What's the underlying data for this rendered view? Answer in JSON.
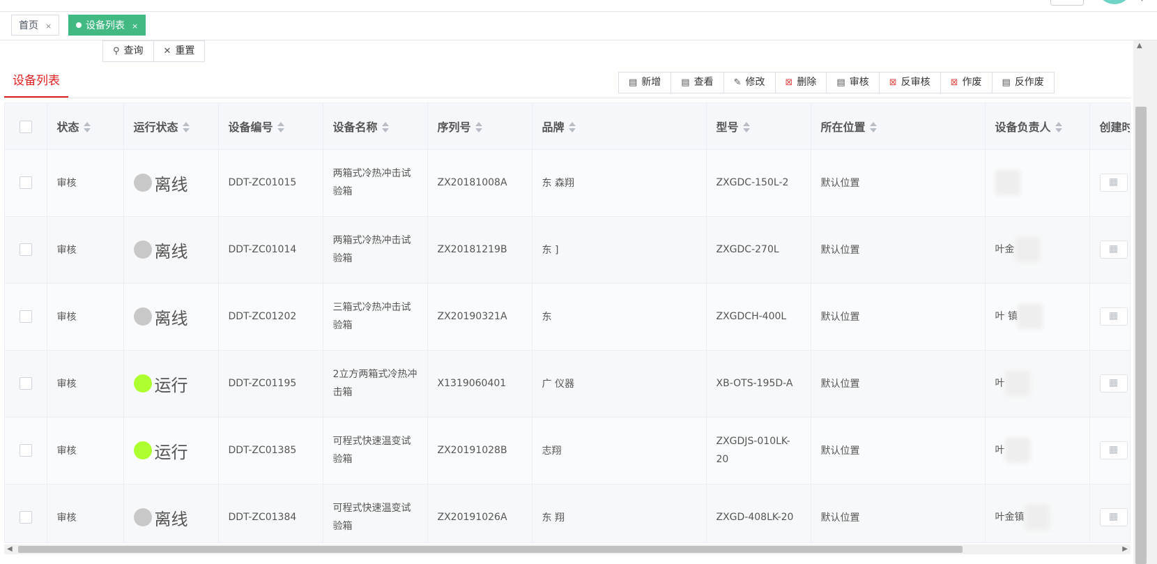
{
  "tags": [
    {
      "label": "首页",
      "active": false
    },
    {
      "label": "设备列表",
      "active": true
    }
  ],
  "query": {
    "search_label": "查询",
    "reset_label": "重置"
  },
  "list_title": "设备列表",
  "toolbar": {
    "add": "新增",
    "view": "查看",
    "edit": "修改",
    "delete": "删除",
    "audit": "审核",
    "unaudit": "反审核",
    "void": "作废",
    "unvoid": "反作废"
  },
  "table": {
    "columns": [
      "状态",
      "运行状态",
      "设备编号",
      "设备名称",
      "序列号",
      "品牌",
      "型号",
      "所在位置",
      "设备负责人",
      "创建时"
    ],
    "rows": [
      {
        "status": "审核",
        "run": "离线",
        "code": "DDT-ZC01015",
        "name": "两箱式冷热冲击试验箱",
        "serial": "ZX20181008A",
        "brand": "东   森翔",
        "model": "ZXGDC-150L-2",
        "location": "默认位置",
        "owner": ""
      },
      {
        "status": "审核",
        "run": "离线",
        "code": "DDT-ZC01014",
        "name": "两箱式冷热冲击试验箱",
        "serial": "ZX20181219B",
        "brand": "东   ]",
        "model": "ZXGDC-270L",
        "location": "默认位置",
        "owner": "叶金"
      },
      {
        "status": "审核",
        "run": "离线",
        "code": "DDT-ZC01202",
        "name": "三箱式冷热冲击试验箱",
        "serial": "ZX20190321A",
        "brand": "东",
        "model": "ZXGDCH-400L",
        "location": "默认位置",
        "owner": "叶   镇"
      },
      {
        "status": "审核",
        "run": "运行",
        "code": "DDT-ZC01195",
        "name": "2立方两箱式冷热冲击箱",
        "serial": "X1319060401",
        "brand": "广   仪器",
        "model": "XB-OTS-195D-A",
        "location": "默认位置",
        "owner": "叶"
      },
      {
        "status": "审核",
        "run": "运行",
        "code": "DDT-ZC01385",
        "name": "可程式快速温变试验箱",
        "serial": "ZX20191028B",
        "brand": "   志翔",
        "model": "ZXGDJS-010LK-20",
        "location": "默认位置",
        "owner": "叶"
      },
      {
        "status": "审核",
        "run": "离线",
        "code": "DDT-ZC01384",
        "name": "可程式快速温变试验箱",
        "serial": "ZX20191026A",
        "brand": "东   翔",
        "model": "ZXGD-408LK-20",
        "location": "默认位置",
        "owner": "叶金镇"
      }
    ]
  },
  "colors": {
    "online": "#adff2f",
    "offline": "#c8c8c8",
    "accent": "#e02020",
    "tag_active": "#42b983"
  }
}
